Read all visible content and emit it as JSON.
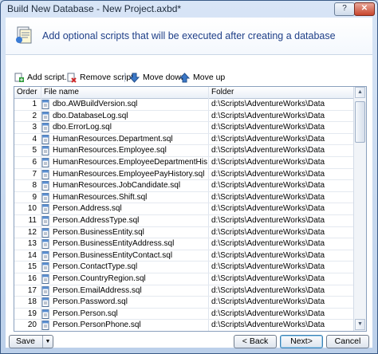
{
  "window": {
    "title": "Build New Database - New Project.axbd*",
    "help_label": "?",
    "close_label": "✕"
  },
  "header": {
    "text": "Add optional scripts that will be executed after creating a database"
  },
  "toolbar": {
    "add": "Add script...",
    "remove": "Remove script",
    "down": "Move down",
    "up": "Move up"
  },
  "columns": {
    "order": "Order",
    "file": "File name",
    "folder": "Folder"
  },
  "rows": [
    {
      "order": "1",
      "file": "dbo.AWBuildVersion.sql",
      "folder": "d:\\Scripts\\AdventureWorks\\Data"
    },
    {
      "order": "2",
      "file": "dbo.DatabaseLog.sql",
      "folder": "d:\\Scripts\\AdventureWorks\\Data"
    },
    {
      "order": "3",
      "file": "dbo.ErrorLog.sql",
      "folder": "d:\\Scripts\\AdventureWorks\\Data"
    },
    {
      "order": "4",
      "file": "HumanResources.Department.sql",
      "folder": "d:\\Scripts\\AdventureWorks\\Data"
    },
    {
      "order": "5",
      "file": "HumanResources.Employee.sql",
      "folder": "d:\\Scripts\\AdventureWorks\\Data"
    },
    {
      "order": "6",
      "file": "HumanResources.EmployeeDepartmentHistory.sql",
      "folder": "d:\\Scripts\\AdventureWorks\\Data"
    },
    {
      "order": "7",
      "file": "HumanResources.EmployeePayHistory.sql",
      "folder": "d:\\Scripts\\AdventureWorks\\Data"
    },
    {
      "order": "8",
      "file": "HumanResources.JobCandidate.sql",
      "folder": "d:\\Scripts\\AdventureWorks\\Data"
    },
    {
      "order": "9",
      "file": "HumanResources.Shift.sql",
      "folder": "d:\\Scripts\\AdventureWorks\\Data"
    },
    {
      "order": "10",
      "file": "Person.Address.sql",
      "folder": "d:\\Scripts\\AdventureWorks\\Data"
    },
    {
      "order": "11",
      "file": "Person.AddressType.sql",
      "folder": "d:\\Scripts\\AdventureWorks\\Data"
    },
    {
      "order": "12",
      "file": "Person.BusinessEntity.sql",
      "folder": "d:\\Scripts\\AdventureWorks\\Data"
    },
    {
      "order": "13",
      "file": "Person.BusinessEntityAddress.sql",
      "folder": "d:\\Scripts\\AdventureWorks\\Data"
    },
    {
      "order": "14",
      "file": "Person.BusinessEntityContact.sql",
      "folder": "d:\\Scripts\\AdventureWorks\\Data"
    },
    {
      "order": "15",
      "file": "Person.ContactType.sql",
      "folder": "d:\\Scripts\\AdventureWorks\\Data"
    },
    {
      "order": "16",
      "file": "Person.CountryRegion.sql",
      "folder": "d:\\Scripts\\AdventureWorks\\Data"
    },
    {
      "order": "17",
      "file": "Person.EmailAddress.sql",
      "folder": "d:\\Scripts\\AdventureWorks\\Data"
    },
    {
      "order": "18",
      "file": "Person.Password.sql",
      "folder": "d:\\Scripts\\AdventureWorks\\Data"
    },
    {
      "order": "19",
      "file": "Person.Person.sql",
      "folder": "d:\\Scripts\\AdventureWorks\\Data"
    },
    {
      "order": "20",
      "file": "Person.PersonPhone.sql",
      "folder": "d:\\Scripts\\AdventureWorks\\Data"
    }
  ],
  "footer": {
    "save": "Save",
    "back": "< Back",
    "next": "Next>",
    "cancel": "Cancel"
  },
  "icons": {
    "header": "scripts-icon",
    "file": "sql-file-icon"
  }
}
